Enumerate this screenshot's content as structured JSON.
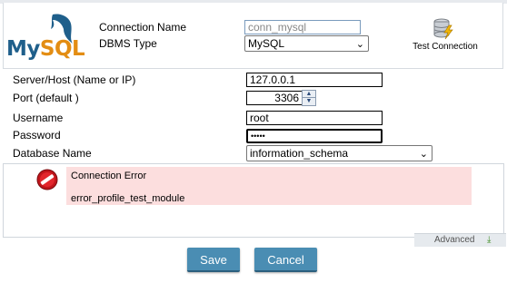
{
  "logo": {
    "text_my": "My",
    "text_sql": "SQL"
  },
  "header": {
    "connection_name_label": "Connection Name",
    "connection_name_value": "conn_mysql",
    "dbms_type_label": "DBMS Type",
    "dbms_type_value": "MySQL",
    "test_connection_label": "Test Connection"
  },
  "form": {
    "server_label": "Server/Host (Name or IP)",
    "server_value": "127.0.0.1",
    "port_label": "Port (default )",
    "port_value": "3306",
    "username_label": "Username",
    "username_value": "root",
    "password_label": "Password",
    "password_value": "•••••",
    "database_label": "Database Name",
    "database_value": "information_schema"
  },
  "message": {
    "title": "Connection Error",
    "detail": "error_profile_test_module",
    "error_color": "#fcdede"
  },
  "advanced": {
    "label": "Advanced"
  },
  "buttons": {
    "save": "Save",
    "cancel": "Cancel",
    "accent": "#4a8db3"
  }
}
